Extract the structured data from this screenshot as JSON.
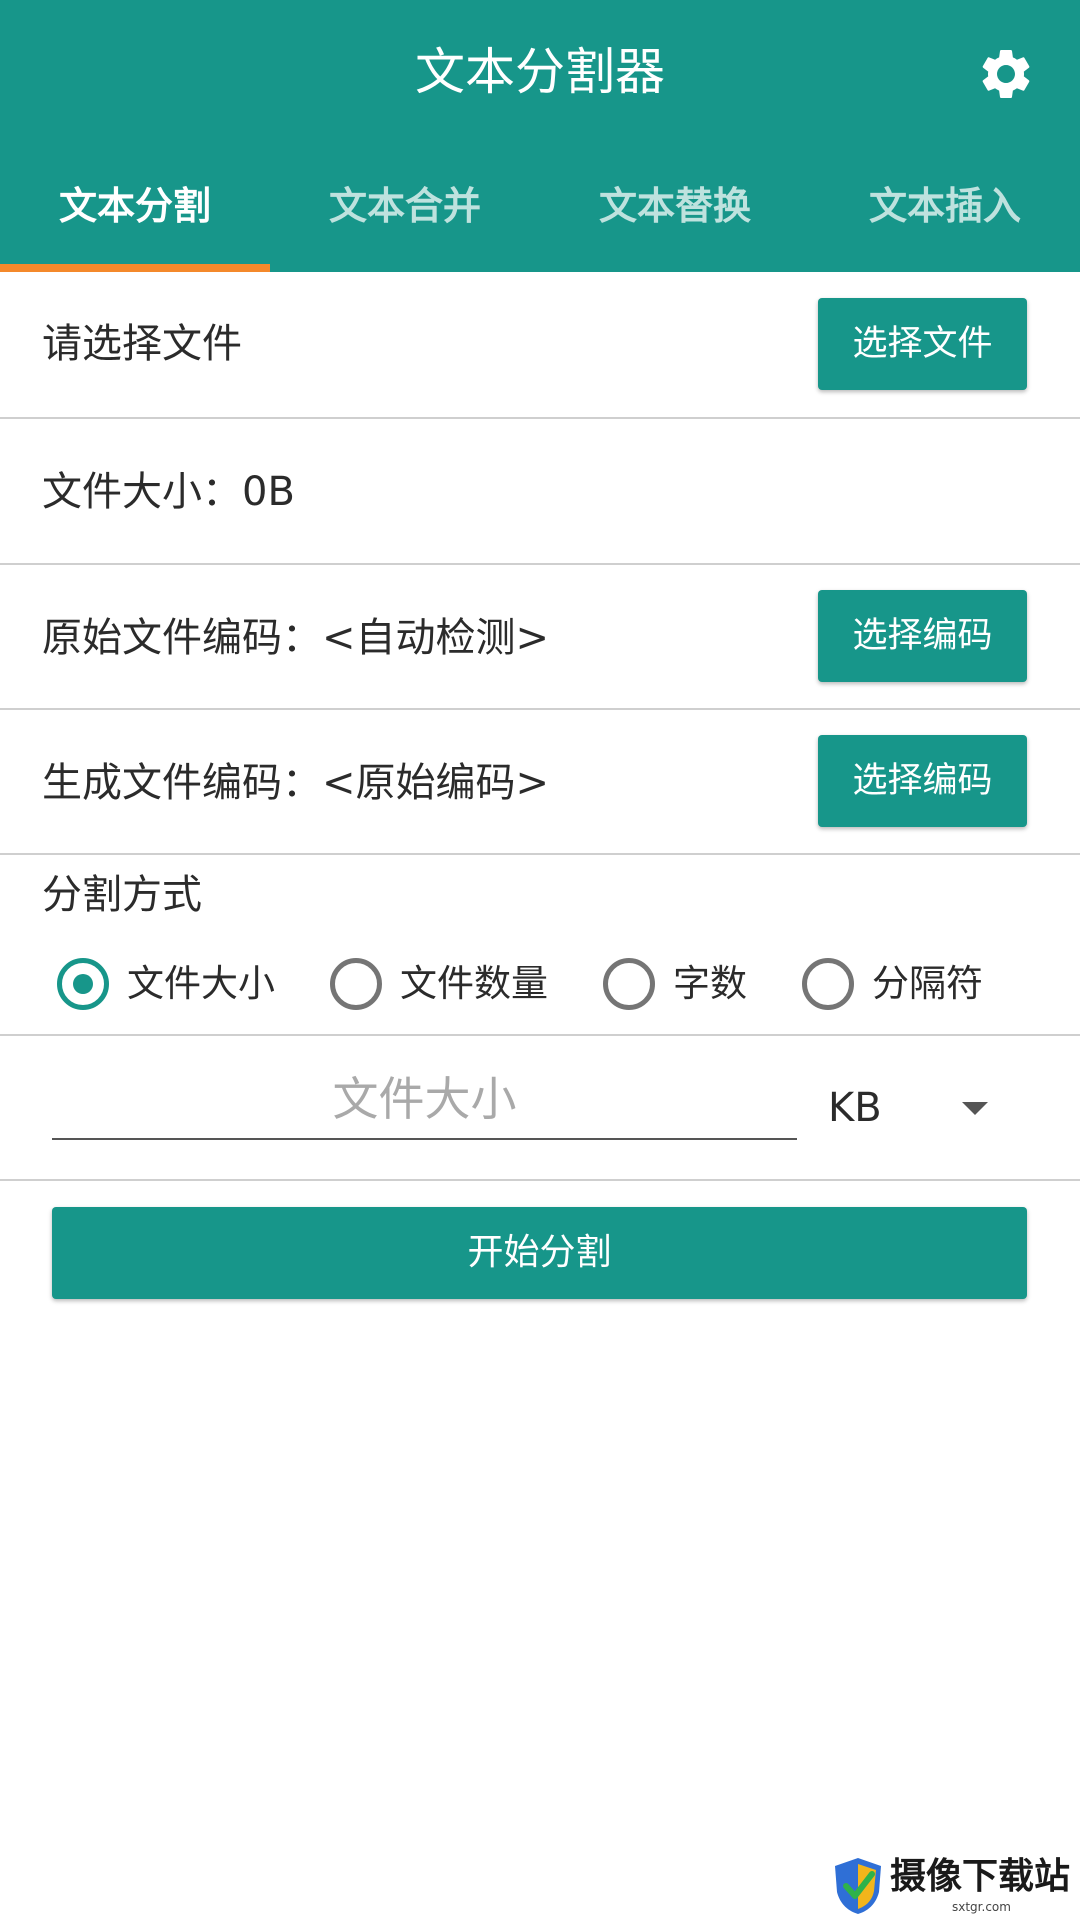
{
  "app": {
    "title": "文本分割器",
    "accent_color": "#17968a",
    "indicator_color": "#f4892b",
    "settings_icon": "gear-icon"
  },
  "tabs": [
    {
      "label": "文本分割",
      "active": true
    },
    {
      "label": "文本合并",
      "active": false
    },
    {
      "label": "文本替换",
      "active": false
    },
    {
      "label": "文本插入",
      "active": false
    }
  ],
  "file": {
    "prompt": "请选择文件",
    "choose_button": "选择文件",
    "size_label": "文件大小：0B"
  },
  "encoding": {
    "source_label": "原始文件编码：<自动检测>",
    "output_label": "生成文件编码：<原始编码>",
    "choose_button": "选择编码"
  },
  "split_mode": {
    "heading": "分割方式",
    "options": [
      {
        "label": "文件大小",
        "checked": true
      },
      {
        "label": "文件数量",
        "checked": false
      },
      {
        "label": "字数",
        "checked": false
      },
      {
        "label": "分隔符",
        "checked": false
      }
    ]
  },
  "size_input": {
    "placeholder": "文件大小",
    "value": ""
  },
  "unit_select": {
    "selected": "KB"
  },
  "start_button": "开始分割",
  "watermark": {
    "name": "摄像下载站",
    "url": "sxtgr.com"
  }
}
